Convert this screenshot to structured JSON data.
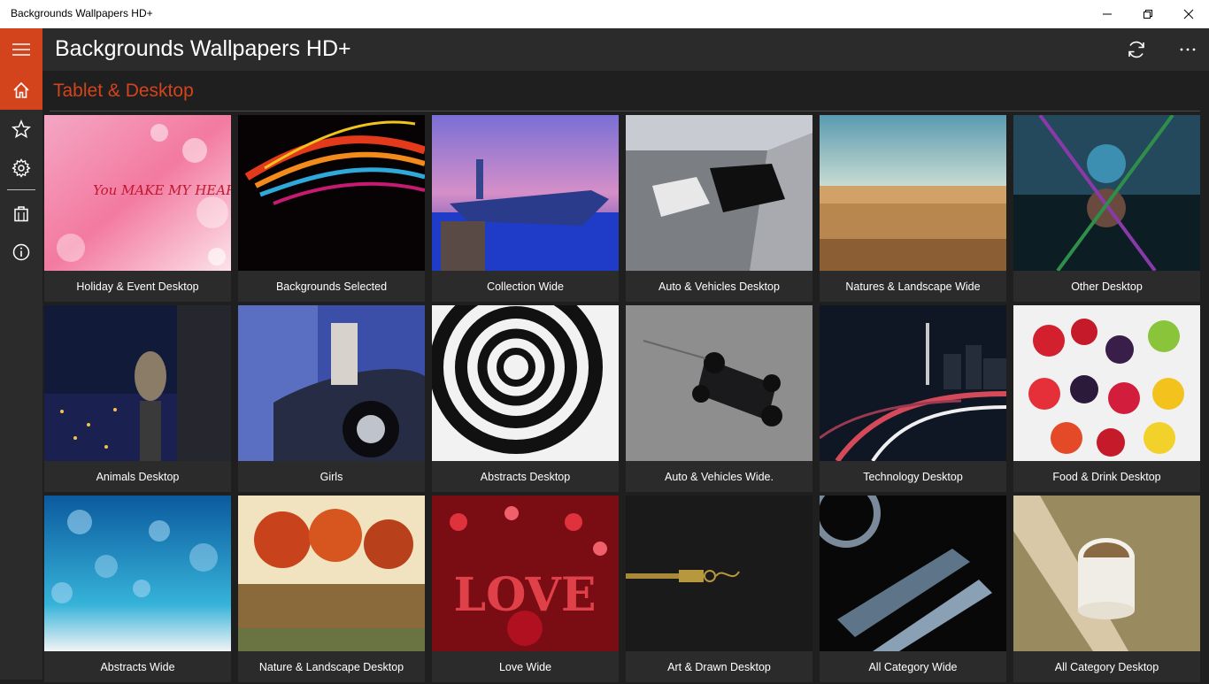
{
  "window": {
    "title": "Backgrounds Wallpapers HD+",
    "minimize_icon": "minimize-icon",
    "maximize_icon": "restore-icon",
    "close_icon": "close-icon"
  },
  "app": {
    "title": "Backgrounds Wallpapers HD+",
    "accent_color": "#d4441c",
    "header_icons": [
      "refresh-icon",
      "more-icon"
    ]
  },
  "nav": {
    "items": [
      "menu-icon",
      "home-icon",
      "star-icon",
      "gear-icon",
      "store-icon",
      "info-icon"
    ]
  },
  "section": {
    "title": "Tablet & Desktop"
  },
  "tiles": [
    {
      "label": "Holiday & Event Desktop"
    },
    {
      "label": "Backgrounds Selected"
    },
    {
      "label": "Collection Wide"
    },
    {
      "label": "Auto & Vehicles Desktop"
    },
    {
      "label": "Natures & Landscape Wide"
    },
    {
      "label": "Other Desktop"
    },
    {
      "label": "Animals Desktop"
    },
    {
      "label": "Girls"
    },
    {
      "label": "Abstracts Desktop"
    },
    {
      "label": "Auto & Vehicles Wide."
    },
    {
      "label": "Technology Desktop"
    },
    {
      "label": "Food & Drink Desktop"
    },
    {
      "label": "Abstracts Wide"
    },
    {
      "label": "Nature & Landscape Desktop"
    },
    {
      "label": "Love Wide"
    },
    {
      "label": "Art & Drawn Desktop"
    },
    {
      "label": "All Category Wide"
    },
    {
      "label": "All Category Desktop"
    }
  ],
  "tile_art": {
    "holiday_text": "You MAKE MY HEART Smile",
    "love_text": "LOVE"
  }
}
